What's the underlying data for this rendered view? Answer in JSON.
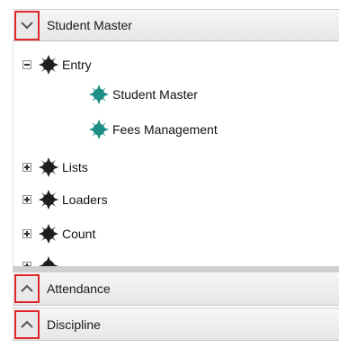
{
  "panels": {
    "student_master": {
      "title": "Student Master",
      "chevron": "chevron-down-icon"
    },
    "attendance": {
      "title": "Attendance",
      "chevron": "chevron-up-icon"
    },
    "discipline": {
      "title": "Discipline",
      "chevron": "chevron-up-icon"
    }
  },
  "tree": {
    "entry": {
      "label": "Entry",
      "expander": "collapse"
    },
    "student_master": {
      "label": "Student Master"
    },
    "fees": {
      "label": "Fees Management"
    },
    "lists": {
      "label": "Lists",
      "expander": "expand"
    },
    "loaders": {
      "label": "Loaders",
      "expander": "expand"
    },
    "count": {
      "label": "Count",
      "expander": "expand"
    }
  },
  "colors": {
    "folder_gear": "#1e1e1e",
    "item_gear": "#1f8f86",
    "highlight_border": "#e0262b"
  }
}
